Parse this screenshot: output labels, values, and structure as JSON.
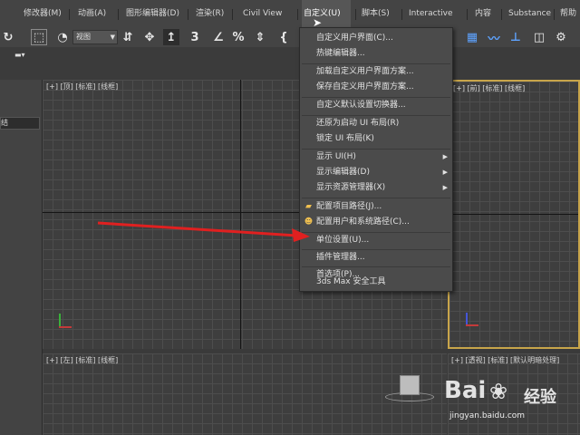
{
  "menubar": {
    "items": [
      {
        "label": "动画(A)"
      },
      {
        "label": "图形编辑器(D)"
      },
      {
        "label": "渲染(R)"
      },
      {
        "label": "Civil View"
      },
      {
        "label": "自定义(U)"
      },
      {
        "label": "脚本(S)"
      },
      {
        "label": "Interactive"
      },
      {
        "label": "内容"
      },
      {
        "label": "Substance"
      },
      {
        "label": "帮助"
      }
    ],
    "cut_label": "修改器(M)"
  },
  "toolbar": {
    "view_select": "视图"
  },
  "left_panel": {
    "field_text": "结"
  },
  "viewports": {
    "top_left": "[+] [顶] [标准] [线框]",
    "top_right": "[+] [前] [标准] [线框]",
    "bottom_left": "[+] [左] [标准] [线框]",
    "bottom_right": "[+] [透视] [标准] [默认明暗处理]"
  },
  "customize_menu": {
    "items": [
      {
        "label": "自定义用户界面(C)..."
      },
      {
        "label": "热键编辑器..."
      },
      {
        "label": "加载自定义用户界面方案..."
      },
      {
        "label": "保存自定义用户界面方案..."
      },
      {
        "label": "自定义默认设置切换器..."
      },
      {
        "label": "还原为启动 UI 布局(R)"
      },
      {
        "label": "锁定 UI 布局(K)"
      },
      {
        "label": "显示 UI(H)"
      },
      {
        "label": "显示编辑器(D)"
      },
      {
        "label": "显示资源管理器(X)"
      },
      {
        "label": "配置项目路径(J)..."
      },
      {
        "label": "配置用户和系统路径(C)..."
      },
      {
        "label": "单位设置(U)..."
      },
      {
        "label": "插件管理器..."
      },
      {
        "label": "首选项(P)..."
      },
      {
        "label": "3ds Max 安全工具"
      }
    ]
  },
  "watermark": {
    "logo": "Bai",
    "logo_suffix": "经验",
    "url": "jingyan.baidu.com"
  },
  "colors": {
    "active_viewport_border": "#c8a54a",
    "arrow": "#e02020"
  }
}
